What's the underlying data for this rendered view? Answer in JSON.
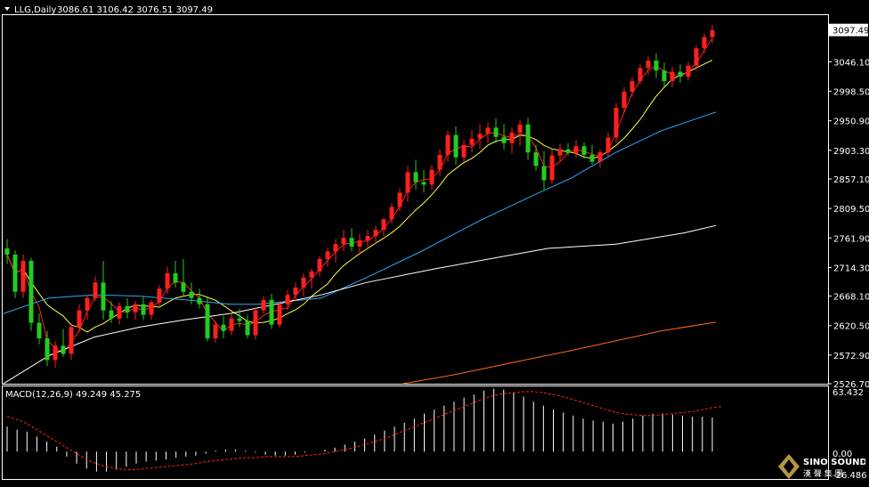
{
  "header": {
    "symbol_label": "LLG,Daily",
    "ohlc_label": "3086.61 3106.42 3076.51 3097.49"
  },
  "price_axis": {
    "ticks": [
      "3046.10",
      "2998.50",
      "2950.90",
      "2903.30",
      "2857.10",
      "2809.50",
      "2761.90",
      "2714.30",
      "2668.10",
      "2620.50",
      "2572.90",
      "2526.70"
    ],
    "tick_values": [
      3046.1,
      2998.5,
      2950.9,
      2903.3,
      2857.1,
      2809.5,
      2761.9,
      2714.3,
      2668.1,
      2620.5,
      2572.9,
      2526.7
    ],
    "current_price_label": "3097.49",
    "current_price": 3097.49
  },
  "macd": {
    "label": "MACD(12,26,9) 49.249 45.275",
    "axis_top": "63.432",
    "axis_zero": "0.00",
    "axis_bottom": "-26.486"
  },
  "watermark": {
    "brand": "SINO SOUND",
    "cn": "漢 聲 集 團"
  },
  "colors": {
    "bull": "#ff2020",
    "bear": "#22cc22",
    "ma_fast": "#ff2020",
    "ma_mid": "#ffff44",
    "ma_blue": "#2aa8ff",
    "ma_white": "#ffffff",
    "ma_orange": "#ff6a1a",
    "macd_hist": "#ffffff",
    "macd_signal": "#ff2020"
  },
  "chart_data": {
    "type": "candlestick",
    "title": "LLG,Daily",
    "ylim": [
      2526.7,
      3120
    ],
    "candles": [
      [
        2745,
        2760,
        2720,
        2735
      ],
      [
        2735,
        2742,
        2665,
        2675
      ],
      [
        2675,
        2735,
        2665,
        2725
      ],
      [
        2725,
        2730,
        2612,
        2625
      ],
      [
        2625,
        2640,
        2590,
        2600
      ],
      [
        2600,
        2612,
        2555,
        2565
      ],
      [
        2565,
        2595,
        2552,
        2588
      ],
      [
        2588,
        2615,
        2570,
        2575
      ],
      [
        2575,
        2625,
        2565,
        2618
      ],
      [
        2618,
        2655,
        2610,
        2645
      ],
      [
        2645,
        2670,
        2630,
        2665
      ],
      [
        2665,
        2700,
        2660,
        2690
      ],
      [
        2690,
        2725,
        2630,
        2645
      ],
      [
        2645,
        2660,
        2625,
        2632
      ],
      [
        2632,
        2658,
        2622,
        2652
      ],
      [
        2652,
        2665,
        2632,
        2642
      ],
      [
        2642,
        2660,
        2630,
        2655
      ],
      [
        2655,
        2668,
        2630,
        2638
      ],
      [
        2638,
        2662,
        2630,
        2658
      ],
      [
        2658,
        2685,
        2652,
        2680
      ],
      [
        2680,
        2715,
        2672,
        2705
      ],
      [
        2705,
        2725,
        2682,
        2690
      ],
      [
        2690,
        2728,
        2668,
        2675
      ],
      [
        2675,
        2690,
        2655,
        2665
      ],
      [
        2665,
        2680,
        2648,
        2655
      ],
      [
        2655,
        2668,
        2595,
        2600
      ],
      [
        2600,
        2628,
        2593,
        2622
      ],
      [
        2622,
        2636,
        2600,
        2612
      ],
      [
        2612,
        2640,
        2605,
        2632
      ],
      [
        2632,
        2648,
        2618,
        2628
      ],
      [
        2628,
        2638,
        2600,
        2605
      ],
      [
        2605,
        2650,
        2598,
        2645
      ],
      [
        2645,
        2668,
        2640,
        2662
      ],
      [
        2662,
        2672,
        2615,
        2622
      ],
      [
        2622,
        2660,
        2618,
        2655
      ],
      [
        2655,
        2678,
        2645,
        2670
      ],
      [
        2670,
        2690,
        2660,
        2682
      ],
      [
        2682,
        2705,
        2668,
        2698
      ],
      [
        2698,
        2712,
        2680,
        2708
      ],
      [
        2708,
        2732,
        2700,
        2728
      ],
      [
        2728,
        2746,
        2715,
        2740
      ],
      [
        2740,
        2760,
        2722,
        2752
      ],
      [
        2752,
        2775,
        2740,
        2762
      ],
      [
        2762,
        2778,
        2740,
        2748
      ],
      [
        2748,
        2768,
        2735,
        2758
      ],
      [
        2758,
        2775,
        2745,
        2765
      ],
      [
        2765,
        2782,
        2752,
        2775
      ],
      [
        2775,
        2795,
        2765,
        2792
      ],
      [
        2792,
        2818,
        2785,
        2812
      ],
      [
        2812,
        2842,
        2805,
        2835
      ],
      [
        2835,
        2878,
        2820,
        2868
      ],
      [
        2868,
        2888,
        2840,
        2852
      ],
      [
        2852,
        2872,
        2835,
        2848
      ],
      [
        2848,
        2880,
        2840,
        2872
      ],
      [
        2872,
        2905,
        2862,
        2896
      ],
      [
        2896,
        2935,
        2885,
        2928
      ],
      [
        2928,
        2942,
        2880,
        2892
      ],
      [
        2892,
        2920,
        2885,
        2912
      ],
      [
        2912,
        2936,
        2900,
        2922
      ],
      [
        2922,
        2945,
        2905,
        2930
      ],
      [
        2930,
        2948,
        2915,
        2940
      ],
      [
        2940,
        2955,
        2915,
        2925
      ],
      [
        2925,
        2946,
        2905,
        2915
      ],
      [
        2915,
        2940,
        2898,
        2932
      ],
      [
        2932,
        2952,
        2910,
        2945
      ],
      [
        2945,
        2956,
        2888,
        2900
      ],
      [
        2900,
        2912,
        2870,
        2878
      ],
      [
        2878,
        2902,
        2840,
        2855
      ],
      [
        2855,
        2905,
        2850,
        2895
      ],
      [
        2895,
        2914,
        2885,
        2905
      ],
      [
        2905,
        2915,
        2895,
        2899
      ],
      [
        2899,
        2920,
        2892,
        2910
      ],
      [
        2910,
        2916,
        2890,
        2896
      ],
      [
        2896,
        2912,
        2880,
        2885
      ],
      [
        2885,
        2905,
        2875,
        2900
      ],
      [
        2900,
        2932,
        2894,
        2924
      ],
      [
        2924,
        2980,
        2915,
        2972
      ],
      [
        2972,
        3005,
        2965,
        2998
      ],
      [
        2998,
        3022,
        2990,
        3015
      ],
      [
        3015,
        3042,
        3010,
        3036
      ],
      [
        3036,
        3055,
        3025,
        3048
      ],
      [
        3048,
        3060,
        3020,
        3032
      ],
      [
        3032,
        3045,
        3005,
        3015
      ],
      [
        3015,
        3038,
        3005,
        3030
      ],
      [
        3030,
        3042,
        3012,
        3022
      ],
      [
        3022,
        3046,
        3016,
        3040
      ],
      [
        3040,
        3072,
        3032,
        3068
      ],
      [
        3068,
        3092,
        3060,
        3086
      ],
      [
        3086,
        3106,
        3076,
        3097
      ]
    ],
    "series": [
      {
        "name": "",
        "color": "ma_blue",
        "values": [
          [
            0,
            2640
          ],
          [
            10,
            2665
          ],
          [
            20,
            2670
          ],
          [
            30,
            2668
          ],
          [
            40,
            2662
          ],
          [
            50,
            2655
          ],
          [
            56,
            2655
          ],
          [
            63,
            2660
          ],
          [
            70,
            2665
          ],
          [
            80,
            2698
          ],
          [
            92,
            2740
          ],
          [
            105,
            2790
          ],
          [
            118,
            2835
          ],
          [
            125,
            2858
          ],
          [
            135,
            2900
          ],
          [
            145,
            2935
          ],
          [
            157,
            2965
          ]
        ]
      },
      {
        "name": "",
        "color": "ma_white",
        "values": [
          [
            0,
            2527
          ],
          [
            10,
            2572
          ],
          [
            20,
            2602
          ],
          [
            30,
            2618
          ],
          [
            40,
            2630
          ],
          [
            50,
            2640
          ],
          [
            60,
            2655
          ],
          [
            70,
            2670
          ],
          [
            80,
            2690
          ],
          [
            95,
            2712
          ],
          [
            110,
            2732
          ],
          [
            120,
            2745
          ],
          [
            135,
            2752
          ],
          [
            150,
            2770
          ],
          [
            157,
            2782
          ]
        ]
      },
      {
        "name": "",
        "color": "ma_orange",
        "values": [
          [
            88,
            2526.7
          ],
          [
            100,
            2542
          ],
          [
            115,
            2565
          ],
          [
            125,
            2580
          ],
          [
            135,
            2596
          ],
          [
            145,
            2612
          ],
          [
            157,
            2626
          ]
        ]
      }
    ],
    "macd": {
      "type": "bar",
      "ylim": [
        -26.486,
        63.432
      ],
      "hist": [
        25,
        22,
        20,
        15,
        10,
        5,
        -5,
        -12,
        -17,
        -20,
        -20,
        -18,
        -15,
        -12,
        -10,
        -9,
        -8,
        -6,
        -5,
        -4,
        -2,
        1,
        2,
        2,
        1,
        -1,
        -3,
        -4,
        -4,
        -3,
        -1,
        0,
        2,
        4,
        7,
        10,
        13,
        17,
        21,
        25,
        29,
        33,
        38,
        42,
        46,
        50,
        54,
        57,
        61,
        63,
        62,
        59,
        55,
        50,
        46,
        42,
        39,
        36,
        33,
        31,
        30,
        28,
        30,
        33,
        36,
        38,
        38,
        37,
        36,
        35,
        35,
        34
      ],
      "signal": [
        35,
        32,
        28,
        22,
        16,
        10,
        4,
        -2,
        -8,
        -12,
        -15,
        -17,
        -18,
        -18,
        -17,
        -16,
        -15,
        -14,
        -13,
        -12,
        -10,
        -9,
        -8,
        -7,
        -6,
        -6,
        -5,
        -5,
        -5,
        -5,
        -4,
        -3,
        -2,
        0,
        2,
        4,
        7,
        10,
        13,
        17,
        21,
        25,
        29,
        33,
        37,
        41,
        45,
        49,
        53,
        56,
        58,
        59,
        60,
        60,
        59,
        57,
        55,
        52,
        49,
        46,
        43,
        40,
        38,
        37,
        36,
        36,
        37,
        38,
        39,
        40,
        42,
        44,
        45
      ]
    }
  }
}
